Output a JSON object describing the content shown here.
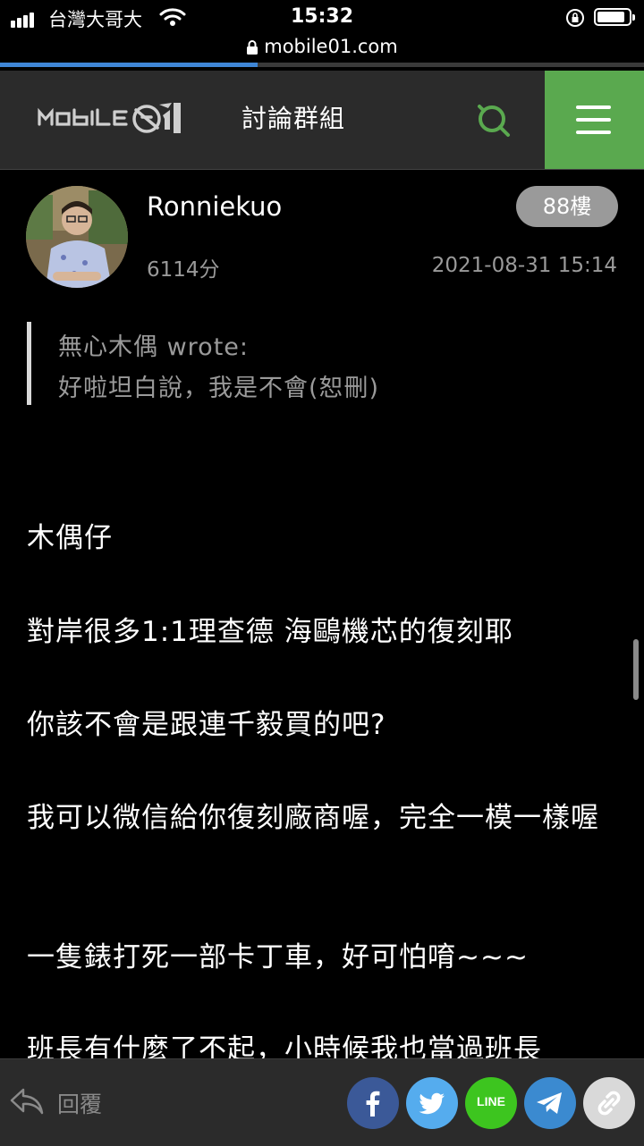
{
  "status_bar": {
    "carrier": "台灣大哥大",
    "time": "15:32"
  },
  "browser": {
    "url": "mobile01.com",
    "load_progress": 0.4
  },
  "nav": {
    "section_title": "討論群組"
  },
  "post": {
    "username": "Ronniekuo",
    "score": "6114分",
    "floor": "88樓",
    "timestamp": "2021-08-31 15:14",
    "quote": {
      "author": "無心木偶 wrote:",
      "text": "好啦坦白說，我是不會(恕刪)"
    },
    "paragraphs": [
      "木偶仔",
      "對岸很多1:1理查德 海鷗機芯的復刻耶",
      "你該不會是跟連千毅買的吧?",
      "我可以微信給你復刻廠商喔，完全一模一樣喔",
      "一隻錶打死一部卡丁車，好可怕唷~~~",
      "班長有什麼了不起，小時候我也當過班長"
    ]
  },
  "bottom_bar": {
    "reply_label": "回覆",
    "share": {
      "line_label": "LINE"
    }
  },
  "colors": {
    "brand_green": "#5aa94f",
    "facebook": "#3b5998",
    "twitter": "#55acee",
    "line": "#3dc51f",
    "telegram": "#3b8ad0"
  }
}
